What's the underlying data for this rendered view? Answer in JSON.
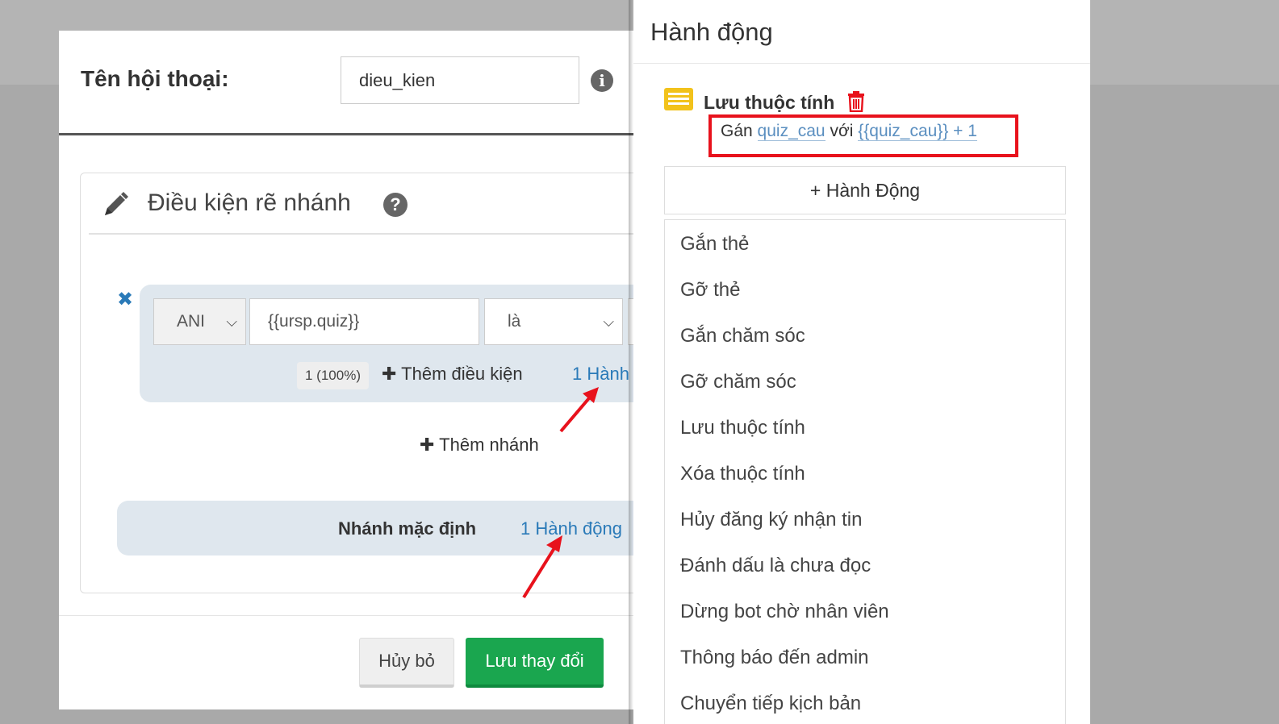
{
  "modal": {
    "name_label": "Tên hội thoại:",
    "name_value": "dieu_kien",
    "panel_title": "Điều kiện rẽ nhánh",
    "branch": {
      "logic": "ANI",
      "condition": "{{ursp.quiz}}",
      "operator": "là",
      "percent": "1 (100%)",
      "add_condition": "Thêm điều kiện",
      "action_link": "1 Hành"
    },
    "add_branch": "Thêm nhánh",
    "default_branch": {
      "label": "Nhánh mặc định",
      "action_link": "1 Hành động"
    },
    "cancel": "Hủy bỏ",
    "save": "Lưu thay đổi"
  },
  "side": {
    "title": "Hành động",
    "action": {
      "name": "Lưu thuộc tính",
      "assign_prefix": "Gán",
      "attribute": "quiz_cau",
      "with_word": "với",
      "value": "{{quiz_cau}} + 1"
    },
    "add_action": "+ Hành Động",
    "menu": [
      "Gắn thẻ",
      "Gỡ thẻ",
      "Gắn chăm sóc",
      "Gỡ chăm sóc",
      "Lưu thuộc tính",
      "Xóa thuộc tính",
      "Hủy đăng ký nhận tin",
      "Đánh dấu là chưa đọc",
      "Dừng bot chờ nhân viên",
      "Thông báo đến admin",
      "Chuyển tiếp kịch bản"
    ]
  },
  "colors": {
    "link": "#2a7ab8",
    "save_button": "#1aa64f",
    "highlight_border": "#e8121c",
    "annotation_arrow": "#e8121c",
    "action_icon": "#f2c21b"
  }
}
